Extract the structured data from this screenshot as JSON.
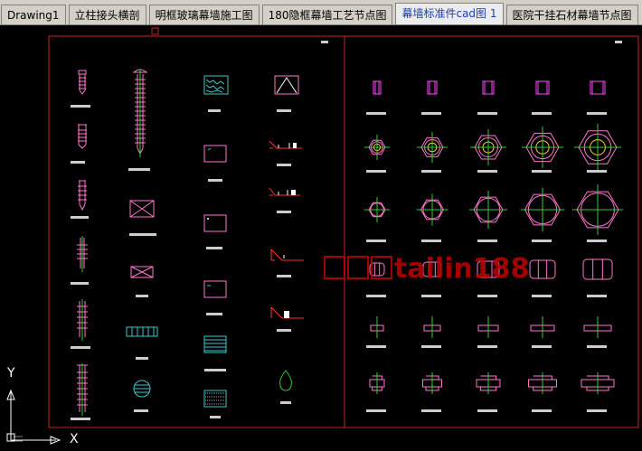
{
  "tabs": [
    {
      "label": "Drawing1",
      "active": false
    },
    {
      "label": "立柱接头横剖",
      "active": false
    },
    {
      "label": "明框玻璃幕墙施工图",
      "active": false
    },
    {
      "label": "180隐框幕墙工艺节点图",
      "active": false
    },
    {
      "label": "幕墙标准件cad图 1",
      "active": true
    },
    {
      "label": "医院干挂石材幕墙节点图",
      "active": false
    }
  ],
  "watermark": "tailin188",
  "ucs": {
    "x_label": "X",
    "y_label": "Y"
  },
  "colors": {
    "background": "#000000",
    "frame": "#cc2222",
    "pink": "#ff66cc",
    "cyan": "#33cccc",
    "green": "#33cc33",
    "magenta": "#ff44ff",
    "white": "#ffffff",
    "watermark": "#c00000"
  }
}
